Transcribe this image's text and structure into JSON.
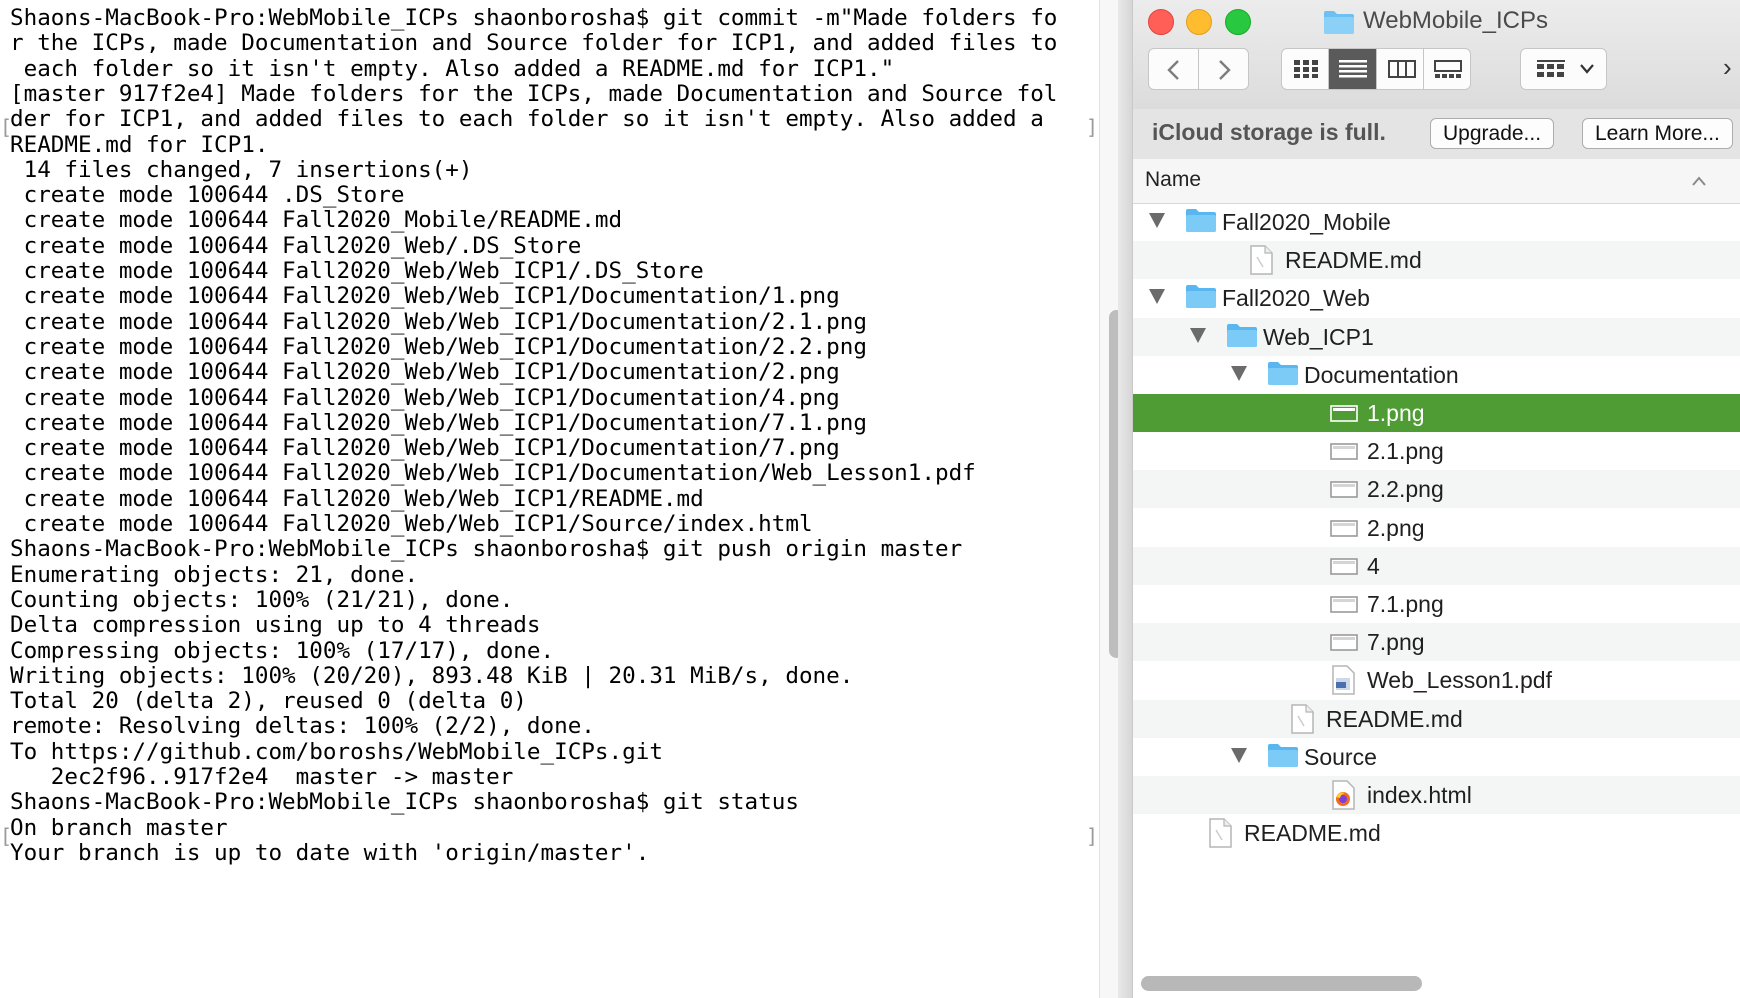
{
  "terminal": {
    "lines": [
      "Shaons-MacBook-Pro:WebMobile_ICPs shaonborosha$ git commit -m\"Made folders fo",
      "r the ICPs, made Documentation and Source folder for ICP1, and added files to",
      " each folder so it isn't empty. Also added a README.md for ICP1.\"",
      "[master 917f2e4] Made folders for the ICPs, made Documentation and Source fol",
      "der for ICP1, and added files to each folder so it isn't empty. Also added a",
      "README.md for ICP1.",
      " 14 files changed, 7 insertions(+)",
      " create mode 100644 .DS_Store",
      " create mode 100644 Fall2020_Mobile/README.md",
      " create mode 100644 Fall2020_Web/.DS_Store",
      " create mode 100644 Fall2020_Web/Web_ICP1/.DS_Store",
      " create mode 100644 Fall2020_Web/Web_ICP1/Documentation/1.png",
      " create mode 100644 Fall2020_Web/Web_ICP1/Documentation/2.1.png",
      " create mode 100644 Fall2020_Web/Web_ICP1/Documentation/2.2.png",
      " create mode 100644 Fall2020_Web/Web_ICP1/Documentation/2.png",
      " create mode 100644 Fall2020_Web/Web_ICP1/Documentation/4.png",
      " create mode 100644 Fall2020_Web/Web_ICP1/Documentation/7.1.png",
      " create mode 100644 Fall2020_Web/Web_ICP1/Documentation/7.png",
      " create mode 100644 Fall2020_Web/Web_ICP1/Documentation/Web_Lesson1.pdf",
      " create mode 100644 Fall2020_Web/Web_ICP1/README.md",
      " create mode 100644 Fall2020_Web/Web_ICP1/Source/index.html",
      "Shaons-MacBook-Pro:WebMobile_ICPs shaonborosha$ git push origin master",
      "Enumerating objects: 21, done.",
      "Counting objects: 100% (21/21), done.",
      "Delta compression using up to 4 threads",
      "Compressing objects: 100% (17/17), done.",
      "Writing objects: 100% (20/20), 893.48 KiB | 20.31 MiB/s, done.",
      "Total 20 (delta 2), reused 0 (delta 0)",
      "remote: Resolving deltas: 100% (2/2), done.",
      "To https://github.com/boroshs/WebMobile_ICPs.git",
      "   2ec2f96..917f2e4  master -> master",
      "Shaons-MacBook-Pro:WebMobile_ICPs shaonborosha$ git status",
      "On branch master",
      "Your branch is up to date with 'origin/master'."
    ]
  },
  "finder": {
    "title": "WebMobile_ICPs",
    "icloud_message": "iCloud storage is full.",
    "upgrade_label": "Upgrade...",
    "learn_more_label": "Learn More...",
    "column_name": "Name",
    "selection_color": "#4f9c34",
    "folder_color": "#58b6f0",
    "items": [
      {
        "label": "Fall2020_Mobile",
        "kind": "folder",
        "depth": 0,
        "expanded": true
      },
      {
        "label": "README.md",
        "kind": "doc",
        "depth": 1
      },
      {
        "label": "Fall2020_Web",
        "kind": "folder",
        "depth": 0,
        "expanded": true
      },
      {
        "label": "Web_ICP1",
        "kind": "folder",
        "depth": 1,
        "expanded": true
      },
      {
        "label": "Documentation",
        "kind": "folder",
        "depth": 2,
        "expanded": true
      },
      {
        "label": "1.png",
        "kind": "image",
        "depth": 3,
        "selected": true
      },
      {
        "label": "2.1.png",
        "kind": "image",
        "depth": 3
      },
      {
        "label": "2.2.png",
        "kind": "image",
        "depth": 3
      },
      {
        "label": "2.png",
        "kind": "image",
        "depth": 3
      },
      {
        "label": "4",
        "kind": "image",
        "depth": 3
      },
      {
        "label": "7.1.png",
        "kind": "image",
        "depth": 3
      },
      {
        "label": "7.png",
        "kind": "image",
        "depth": 3
      },
      {
        "label": "Web_Lesson1.pdf",
        "kind": "pdf",
        "depth": 3
      },
      {
        "label": "README.md",
        "kind": "doc",
        "depth": 2
      },
      {
        "label": "Source",
        "kind": "folder",
        "depth": 2,
        "expanded": true
      },
      {
        "label": "index.html",
        "kind": "html",
        "depth": 3
      },
      {
        "label": "README.md",
        "kind": "doc",
        "depth": 0
      }
    ]
  }
}
